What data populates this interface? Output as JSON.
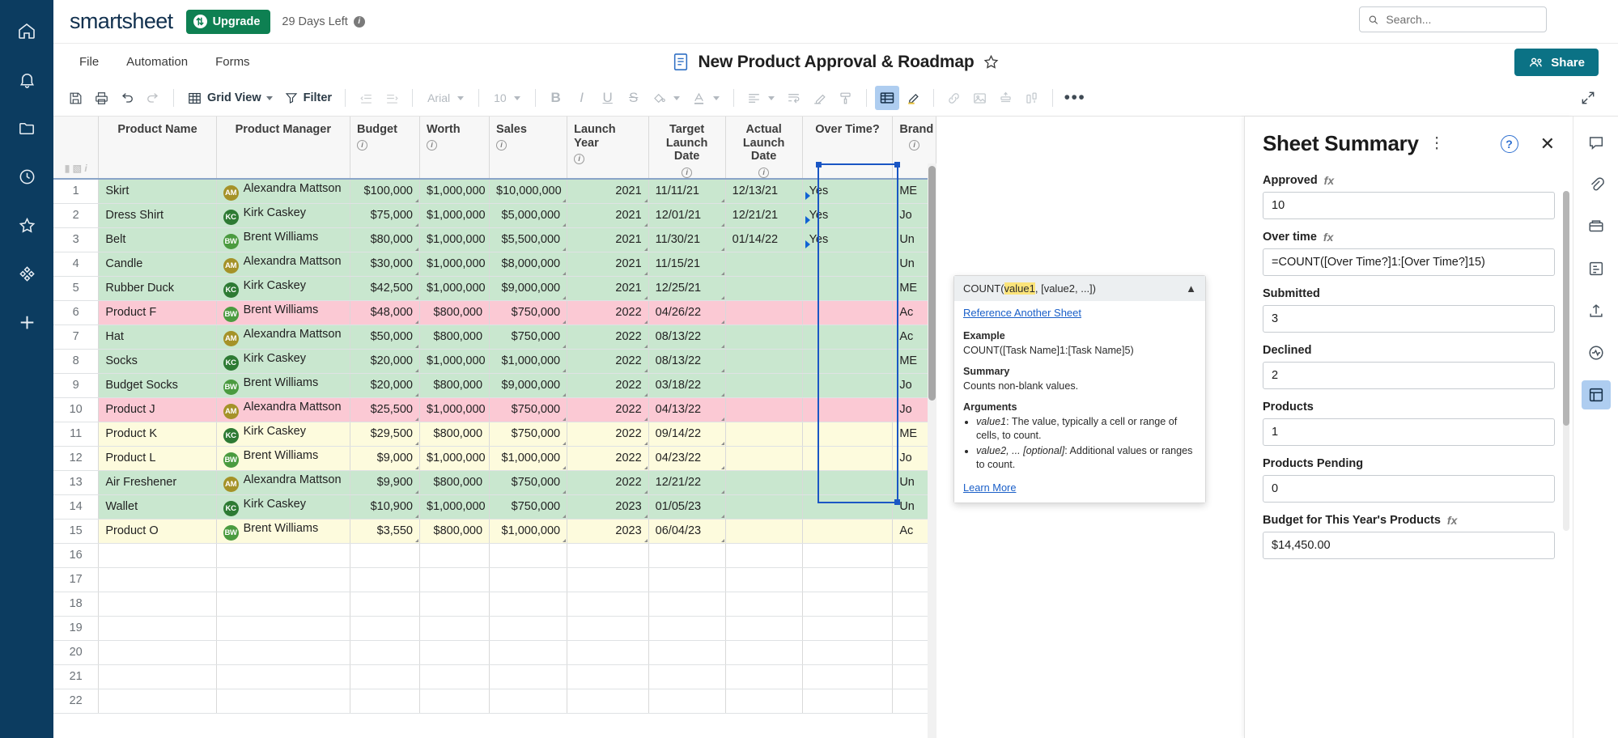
{
  "app": {
    "logo": "smartsheet",
    "upgrade_label": "Upgrade",
    "days_left": "29 Days Left",
    "accent_green": "#0e8052",
    "accent_teal": "#0b7285",
    "rail_bg": "#0c3c60"
  },
  "search": {
    "placeholder": "Search...",
    "value": ""
  },
  "menu": {
    "items": [
      "File",
      "Automation",
      "Forms"
    ]
  },
  "document": {
    "title": "New Product Approval & Roadmap",
    "starred": false
  },
  "share": {
    "label": "Share"
  },
  "toolbar": {
    "grid_view_label": "Grid View",
    "filter_label": "Filter",
    "font_name": "Arial",
    "font_size": "10",
    "icons": [
      "save-icon",
      "print-icon",
      "undo-icon",
      "redo-icon",
      "grid-view-icon",
      "filter-icon",
      "decrease-indent-icon",
      "increase-indent-icon",
      "bold-icon",
      "italic-icon",
      "underline-icon",
      "strikethrough-icon",
      "fill-color-icon",
      "font-color-icon",
      "align-left-icon",
      "wrap-text-icon",
      "clear-format-icon",
      "format-painter-icon",
      "card-view-icon",
      "highlighter-icon",
      "link-icon",
      "image-icon",
      "lock-row-icon",
      "column-chart-icon",
      "more-options-icon",
      "expand-icon"
    ]
  },
  "grid": {
    "columns": [
      {
        "key": "rownum",
        "label": "",
        "info": false
      },
      {
        "key": "name",
        "label": "Product Name",
        "info": false
      },
      {
        "key": "manager",
        "label": "Product Manager",
        "info": false
      },
      {
        "key": "budget",
        "label": "Budget",
        "info": true
      },
      {
        "key": "worth",
        "label": "Worth",
        "info": true
      },
      {
        "key": "sales",
        "label": "Sales",
        "info": true
      },
      {
        "key": "year",
        "label": "Launch Year",
        "info": true
      },
      {
        "key": "target",
        "label": "Target Launch Date",
        "info": true
      },
      {
        "key": "actual",
        "label": "Actual Launch Date",
        "info": true
      },
      {
        "key": "over",
        "label": "Over Time?",
        "info": false
      },
      {
        "key": "brand",
        "label": "Brand",
        "info": true
      }
    ],
    "rows": [
      {
        "n": "1",
        "name": "Skirt",
        "mgr": "Alexandra Mattson",
        "ini": "AM",
        "av": "#a59228",
        "budget": "$100,000",
        "worth": "$1,000,000",
        "sales": "$10,000,000",
        "year": "2021",
        "target": "11/11/21",
        "actual": "12/13/21",
        "over": "Yes",
        "brand": "ME",
        "fill": "green"
      },
      {
        "n": "2",
        "name": "Dress Shirt",
        "mgr": "Kirk Caskey",
        "ini": "KC",
        "av": "#2d7a33",
        "budget": "$75,000",
        "worth": "$1,000,000",
        "sales": "$5,000,000",
        "year": "2021",
        "target": "12/01/21",
        "actual": "12/21/21",
        "over": "Yes",
        "brand": "Jo",
        "fill": "green"
      },
      {
        "n": "3",
        "name": "Belt",
        "mgr": "Brent Williams",
        "ini": "BW",
        "av": "#4a9b3f",
        "budget": "$80,000",
        "worth": "$1,000,000",
        "sales": "$5,500,000",
        "year": "2021",
        "target": "11/30/21",
        "actual": "01/14/22",
        "over": "Yes",
        "brand": "Un",
        "fill": "green"
      },
      {
        "n": "4",
        "name": "Candle",
        "mgr": "Alexandra Mattson",
        "ini": "AM",
        "av": "#a59228",
        "budget": "$30,000",
        "worth": "$1,000,000",
        "sales": "$8,000,000",
        "year": "2021",
        "target": "11/15/21",
        "actual": "",
        "over": "",
        "brand": "Un",
        "fill": "green"
      },
      {
        "n": "5",
        "name": "Rubber Duck",
        "mgr": "Kirk Caskey",
        "ini": "KC",
        "av": "#2d7a33",
        "budget": "$42,500",
        "worth": "$1,000,000",
        "sales": "$9,000,000",
        "year": "2021",
        "target": "12/25/21",
        "actual": "",
        "over": "",
        "brand": "ME",
        "fill": "green"
      },
      {
        "n": "6",
        "name": "Product F",
        "mgr": "Brent Williams",
        "ini": "BW",
        "av": "#4a9b3f",
        "budget": "$48,000",
        "worth": "$800,000",
        "sales": "$750,000",
        "year": "2022",
        "target": "04/26/22",
        "actual": "",
        "over": "",
        "brand": "Ac",
        "fill": "pink"
      },
      {
        "n": "7",
        "name": "Hat",
        "mgr": "Alexandra Mattson",
        "ini": "AM",
        "av": "#a59228",
        "budget": "$50,000",
        "worth": "$800,000",
        "sales": "$750,000",
        "year": "2022",
        "target": "08/13/22",
        "actual": "",
        "over": "",
        "brand": "Ac",
        "fill": "green"
      },
      {
        "n": "8",
        "name": "Socks",
        "mgr": "Kirk Caskey",
        "ini": "KC",
        "av": "#2d7a33",
        "budget": "$20,000",
        "worth": "$1,000,000",
        "sales": "$1,000,000",
        "year": "2022",
        "target": "08/13/22",
        "actual": "",
        "over": "",
        "brand": "ME",
        "fill": "green"
      },
      {
        "n": "9",
        "name": "Budget Socks",
        "mgr": "Brent Williams",
        "ini": "BW",
        "av": "#4a9b3f",
        "budget": "$20,000",
        "worth": "$800,000",
        "sales": "$9,000,000",
        "year": "2022",
        "target": "03/18/22",
        "actual": "",
        "over": "",
        "brand": "Jo",
        "fill": "green"
      },
      {
        "n": "10",
        "name": "Product J",
        "mgr": "Alexandra Mattson",
        "ini": "AM",
        "av": "#a59228",
        "budget": "$25,500",
        "worth": "$1,000,000",
        "sales": "$750,000",
        "year": "2022",
        "target": "04/13/22",
        "actual": "",
        "over": "",
        "brand": "Jo",
        "fill": "pink"
      },
      {
        "n": "11",
        "name": "Product K",
        "mgr": "Kirk Caskey",
        "ini": "KC",
        "av": "#2d7a33",
        "budget": "$29,500",
        "worth": "$800,000",
        "sales": "$750,000",
        "year": "2022",
        "target": "09/14/22",
        "actual": "",
        "over": "",
        "brand": "ME",
        "fill": "cream"
      },
      {
        "n": "12",
        "name": "Product L",
        "mgr": "Brent Williams",
        "ini": "BW",
        "av": "#4a9b3f",
        "budget": "$9,000",
        "worth": "$1,000,000",
        "sales": "$1,000,000",
        "year": "2022",
        "target": "04/23/22",
        "actual": "",
        "over": "",
        "brand": "Jo",
        "fill": "cream"
      },
      {
        "n": "13",
        "name": "Air Freshener",
        "mgr": "Alexandra Mattson",
        "ini": "AM",
        "av": "#a59228",
        "budget": "$9,900",
        "worth": "$800,000",
        "sales": "$750,000",
        "year": "2022",
        "target": "12/21/22",
        "actual": "",
        "over": "",
        "brand": "Un",
        "fill": "green"
      },
      {
        "n": "14",
        "name": "Wallet",
        "mgr": "Kirk Caskey",
        "ini": "KC",
        "av": "#2d7a33",
        "budget": "$10,900",
        "worth": "$1,000,000",
        "sales": "$750,000",
        "year": "2023",
        "target": "01/05/23",
        "actual": "",
        "over": "",
        "brand": "Un",
        "fill": "green"
      },
      {
        "n": "15",
        "name": "Product O",
        "mgr": "Brent Williams",
        "ini": "BW",
        "av": "#4a9b3f",
        "budget": "$3,550",
        "worth": "$800,000",
        "sales": "$1,000,000",
        "year": "2023",
        "target": "06/04/23",
        "actual": "",
        "over": "",
        "brand": "Ac",
        "fill": "cream"
      },
      {
        "n": "16",
        "name": "",
        "mgr": "",
        "ini": "",
        "av": "",
        "budget": "",
        "worth": "",
        "sales": "",
        "year": "",
        "target": "",
        "actual": "",
        "over": "",
        "brand": "",
        "fill": "none"
      },
      {
        "n": "17",
        "name": "",
        "mgr": "",
        "ini": "",
        "av": "",
        "budget": "",
        "worth": "",
        "sales": "",
        "year": "",
        "target": "",
        "actual": "",
        "over": "",
        "brand": "",
        "fill": "none"
      },
      {
        "n": "18",
        "name": "",
        "mgr": "",
        "ini": "",
        "av": "",
        "budget": "",
        "worth": "",
        "sales": "",
        "year": "",
        "target": "",
        "actual": "",
        "over": "",
        "brand": "",
        "fill": "none"
      },
      {
        "n": "19",
        "name": "",
        "mgr": "",
        "ini": "",
        "av": "",
        "budget": "",
        "worth": "",
        "sales": "",
        "year": "",
        "target": "",
        "actual": "",
        "over": "",
        "brand": "",
        "fill": "none"
      },
      {
        "n": "20",
        "name": "",
        "mgr": "",
        "ini": "",
        "av": "",
        "budget": "",
        "worth": "",
        "sales": "",
        "year": "",
        "target": "",
        "actual": "",
        "over": "",
        "brand": "",
        "fill": "none"
      },
      {
        "n": "21",
        "name": "",
        "mgr": "",
        "ini": "",
        "av": "",
        "budget": "",
        "worth": "",
        "sales": "",
        "year": "",
        "target": "",
        "actual": "",
        "over": "",
        "brand": "",
        "fill": "none"
      },
      {
        "n": "22",
        "name": "",
        "mgr": "",
        "ini": "",
        "av": "",
        "budget": "",
        "worth": "",
        "sales": "",
        "year": "",
        "target": "",
        "actual": "",
        "over": "",
        "brand": "",
        "fill": "none"
      }
    ]
  },
  "summary": {
    "title": "Sheet Summary",
    "fields": [
      {
        "label": "Approved",
        "fx": true,
        "value": "10"
      },
      {
        "label": "Over time",
        "fx": true,
        "value": "=COUNT([Over Time?]1:[Over Time?]15)",
        "formula": true
      },
      {
        "label": "Submitted",
        "fx": false,
        "value": "3"
      },
      {
        "label": "Declined",
        "fx": false,
        "value": "2"
      },
      {
        "label": "Products",
        "fx": false,
        "value": "1"
      },
      {
        "label": "Products Pending",
        "fx": false,
        "value": "0"
      },
      {
        "label": "Budget for This Year's Products",
        "fx": true,
        "value": "$14,450.00"
      }
    ]
  },
  "formula_tooltip": {
    "signature_prefix": "COUNT(",
    "signature_arg": "value1",
    "signature_suffix": ", [value2, ...])",
    "reference_link": "Reference Another Sheet",
    "example_title": "Example",
    "example_body": "COUNT([Task Name]1:[Task Name]5)",
    "summary_title": "Summary",
    "summary_body": "Counts non-blank values.",
    "arguments_title": "Arguments",
    "arguments": [
      {
        "name": "value1",
        "rest": ": The value, typically a cell or range of cells, to count."
      },
      {
        "name": "value2, ...",
        "opt": " [optional]",
        "rest": ": Additional values or ranges to count."
      }
    ],
    "learn_more": "Learn More"
  },
  "right_rail": {
    "icons": [
      "comments-icon",
      "attachments-icon",
      "proofs-icon",
      "update-request-icon",
      "publish-icon",
      "activity-log-icon",
      "sheet-summary-icon"
    ]
  }
}
